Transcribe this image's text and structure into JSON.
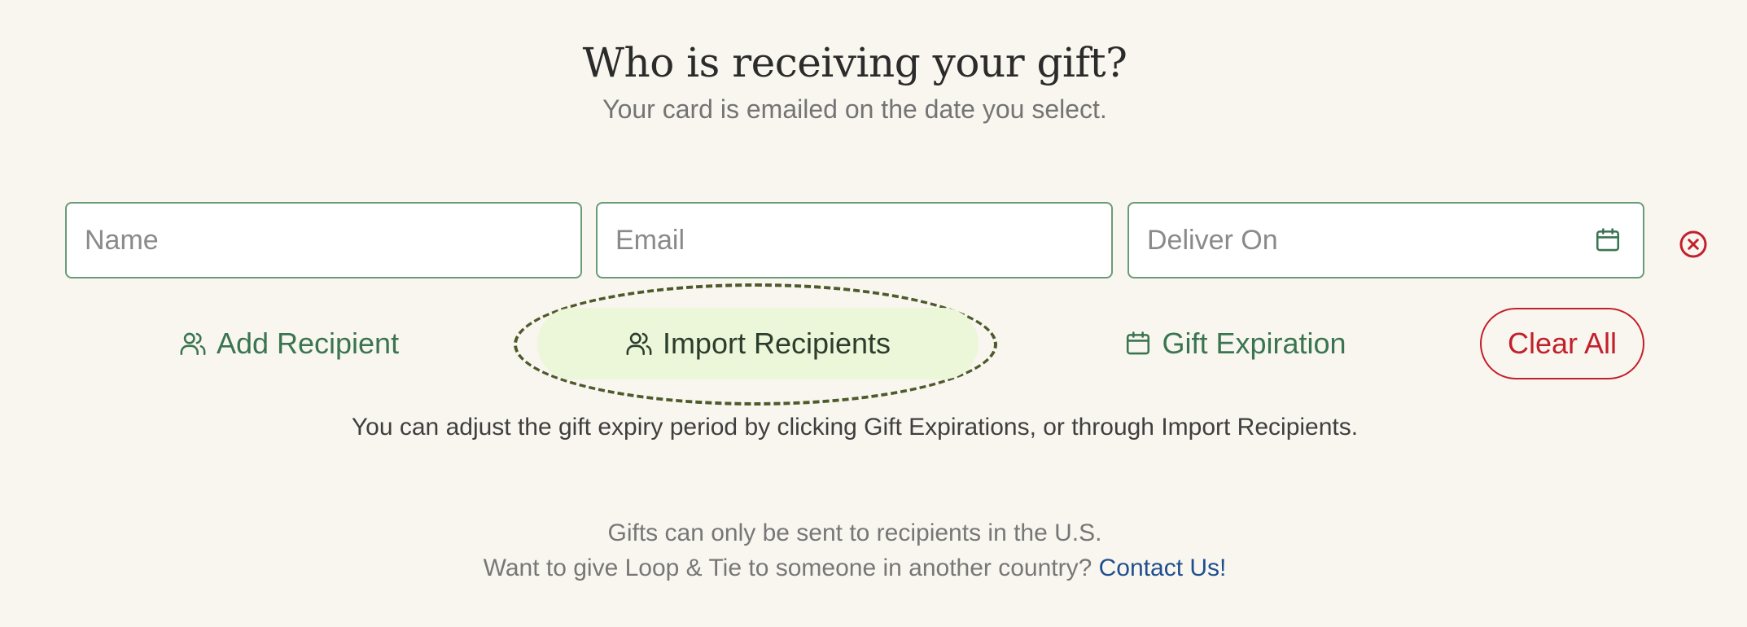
{
  "header": {
    "title": "Who is receiving your gift?",
    "subtitle": "Your card is emailed on the date you select."
  },
  "form": {
    "name": {
      "placeholder": "Name",
      "value": ""
    },
    "email": {
      "placeholder": "Email",
      "value": ""
    },
    "deliver_on": {
      "placeholder": "Deliver On",
      "value": ""
    }
  },
  "actions": {
    "add_recipient": "Add Recipient",
    "import_recipients": "Import Recipients",
    "gift_expiration": "Gift Expiration",
    "clear_all": "Clear All"
  },
  "hint": "You can adjust the gift expiry period by clicking Gift Expirations, or through Import Recipients.",
  "footer": {
    "line1": "Gifts can only be sent to recipients in the U.S.",
    "line2_text": "Want to give Loop & Tie to someone in another country?",
    "contact_link": "Contact Us!"
  },
  "icons": {
    "calendar": "calendar-icon",
    "remove": "remove-circle-x-icon",
    "users": "users-icon"
  },
  "colors": {
    "background": "#f9f6ef",
    "accent_green": "#3a7551",
    "field_border": "#6a9b78",
    "danger_red": "#c2202c",
    "highlight_fill": "#ecf6d8",
    "link_blue": "#1f4f8f"
  }
}
